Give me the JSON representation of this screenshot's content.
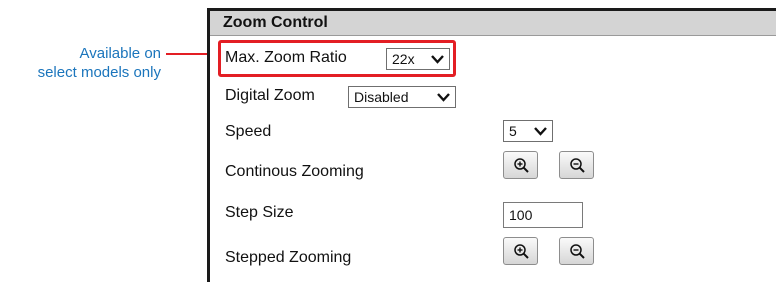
{
  "annotation": {
    "line1": "Available on",
    "line2": "select models only",
    "text_color": "#1b75bc",
    "highlight_color": "#e31e24"
  },
  "panel": {
    "title": "Zoom Control",
    "max_zoom_ratio": {
      "label": "Max. Zoom Ratio",
      "value": "22x"
    },
    "digital_zoom": {
      "label": "Digital Zoom",
      "value": "Disabled"
    },
    "speed": {
      "label": "Speed",
      "value": "5"
    },
    "continuous_zooming": {
      "label": "Continous Zooming",
      "zoom_in_icon": "zoom-in-icon",
      "zoom_out_icon": "zoom-out-icon"
    },
    "step_size": {
      "label": "Step Size",
      "value": "100"
    },
    "stepped_zooming": {
      "label": "Stepped Zooming",
      "zoom_in_icon": "zoom-in-icon",
      "zoom_out_icon": "zoom-out-icon"
    }
  }
}
